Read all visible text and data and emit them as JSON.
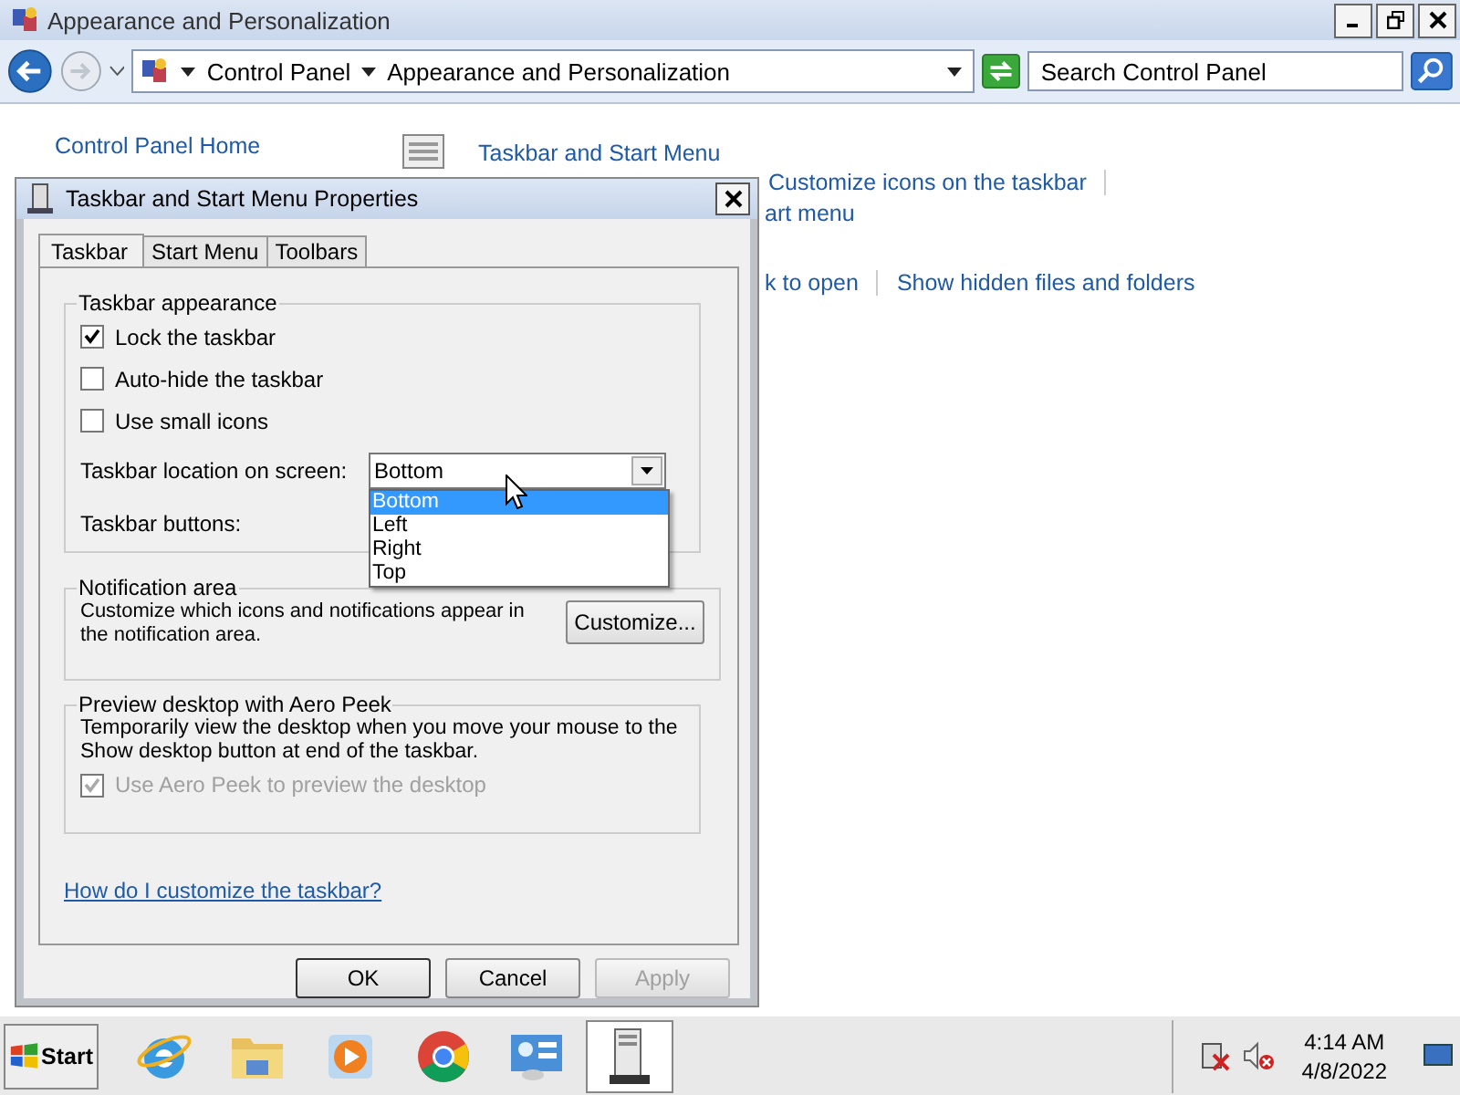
{
  "window": {
    "title": "Appearance and Personalization",
    "breadcrumbs": [
      "Control Panel",
      "Appearance and Personalization"
    ],
    "search": {
      "placeholder": "Search Control Panel"
    }
  },
  "background": {
    "home_link": "Control Panel Home",
    "section_title": "Taskbar and Start Menu",
    "links": [
      {
        "text": "Customize icons on the taskbar"
      },
      {
        "text": "art menu"
      },
      {
        "text": "k to open"
      },
      {
        "text": "Show hidden files and folders"
      }
    ]
  },
  "dialog": {
    "title": "Taskbar and Start Menu Properties",
    "tabs": [
      {
        "label": "Taskbar",
        "selected": true
      },
      {
        "label": "Start Menu",
        "selected": false
      },
      {
        "label": "Toolbars",
        "selected": false
      }
    ],
    "appearance": {
      "legend": "Taskbar appearance",
      "checkboxes": [
        {
          "label": "Lock the taskbar",
          "checked": true
        },
        {
          "label": "Auto-hide the taskbar",
          "checked": false
        },
        {
          "label": "Use small icons",
          "checked": false
        }
      ],
      "location_label": "Taskbar location on screen:",
      "location_value": "Bottom",
      "options": [
        {
          "label": "Bottom",
          "selected": true
        },
        {
          "label": "Left",
          "selected": false
        },
        {
          "label": "Right",
          "selected": false
        },
        {
          "label": "Top",
          "selected": false
        }
      ],
      "buttons_label": "Taskbar buttons:"
    },
    "notification": {
      "legend": "Notification area",
      "text": "Customize which icons and notifications appear in the notification area.",
      "button": "Customize..."
    },
    "peek": {
      "legend": "Preview desktop with Aero Peek",
      "text": "Temporarily view the desktop when you move your mouse to the Show desktop button at end of the taskbar.",
      "checkbox": {
        "label": "Use Aero Peek to preview the desktop",
        "checked": true,
        "disabled": true
      }
    },
    "help_link": "How do I customize the taskbar?",
    "buttons": [
      {
        "label": "OK",
        "disabled": false
      },
      {
        "label": "Cancel",
        "disabled": false
      },
      {
        "label": "Apply",
        "disabled": true
      }
    ]
  },
  "taskbar": {
    "start": "Start",
    "apps": [
      {
        "kind": "browser",
        "selected": false
      },
      {
        "kind": "folder",
        "selected": false
      },
      {
        "kind": "media",
        "selected": false
      },
      {
        "kind": "globe",
        "selected": false
      },
      {
        "kind": "panel",
        "selected": false
      },
      {
        "kind": "window",
        "selected": true
      }
    ],
    "time": "4:14 AM",
    "date": "4/8/2022"
  }
}
